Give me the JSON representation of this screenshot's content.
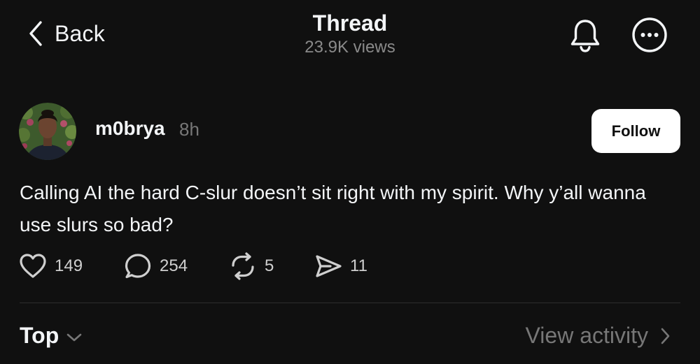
{
  "header": {
    "back_label": "Back",
    "title": "Thread",
    "views": "23.9K views",
    "back_icon": "chevron-left-icon",
    "notifications_icon": "bell-icon",
    "more_icon": "more-options-icon"
  },
  "post": {
    "username": "m0brya",
    "time": "8h",
    "follow_label": "Follow",
    "text": "Calling AI the hard C-slur doesn’t sit right with my spirit. Why y’all wanna use slurs so bad?",
    "actions": {
      "likes": "149",
      "replies": "254",
      "reposts": "5",
      "shares": "11"
    }
  },
  "footer": {
    "sort_label": "Top",
    "view_activity_label": "View activity"
  },
  "colors": {
    "background": "#101010",
    "primary_text": "#f3f5f7",
    "secondary_text": "#777777",
    "follow_button_bg": "#ffffff",
    "divider": "#2d2d2d"
  }
}
